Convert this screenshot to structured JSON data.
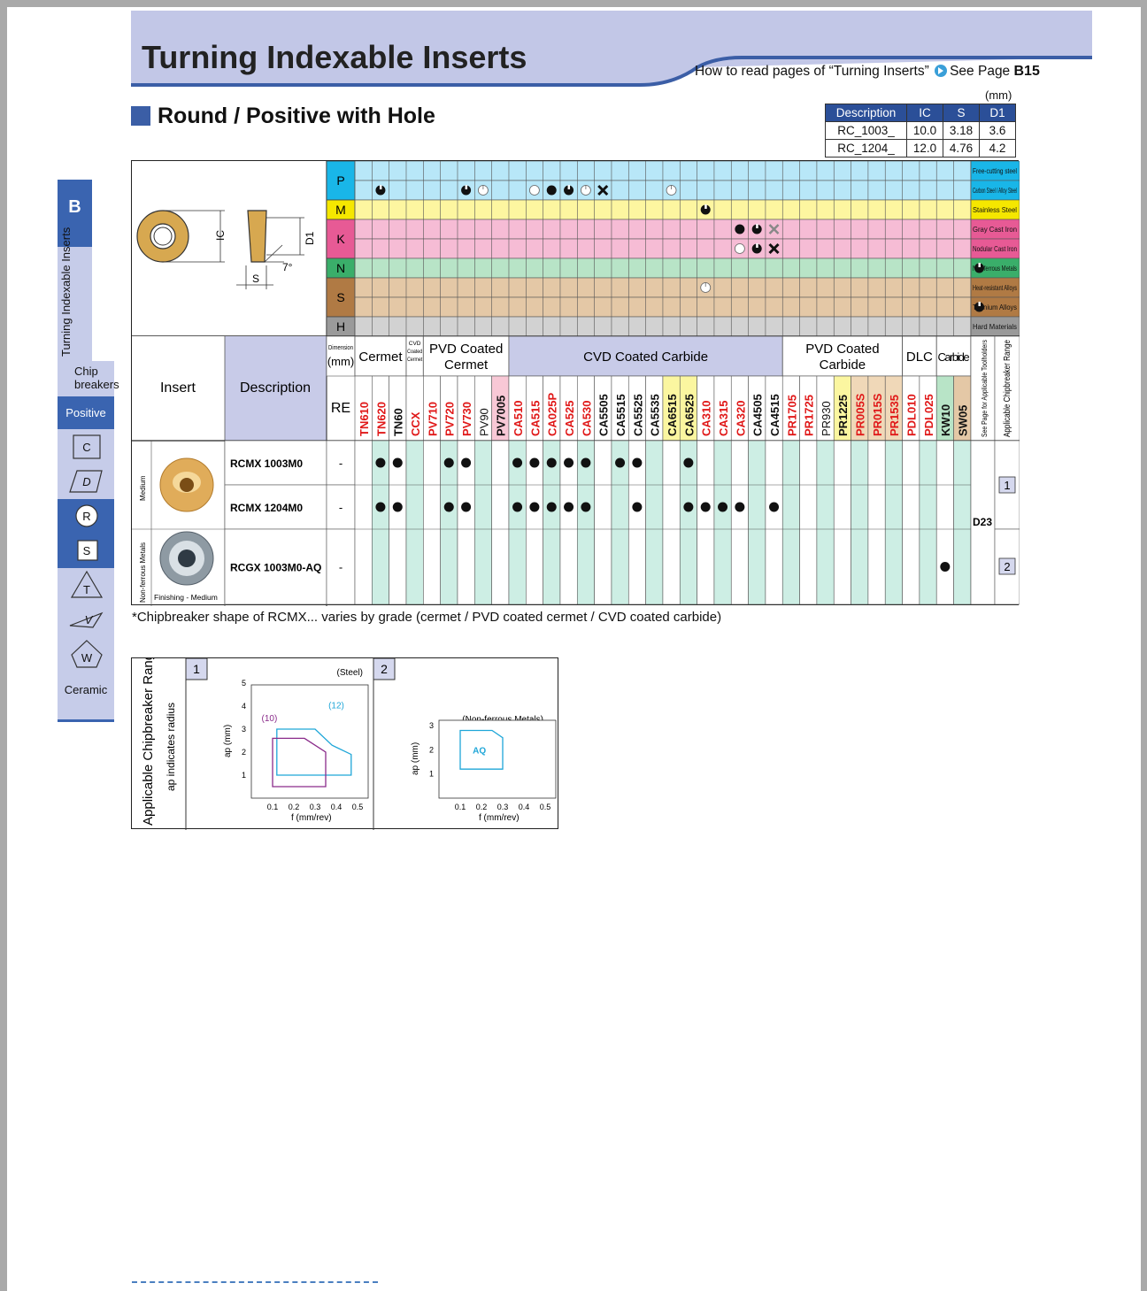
{
  "header": {
    "title": "Turning Indexable Inserts",
    "howto_text": "How to read pages of “Turning Inserts”",
    "see_page_text": "See Page",
    "see_page_ref": "B15"
  },
  "section": {
    "title": "Round / Positive with Hole"
  },
  "dimensions": {
    "unit": "(mm)",
    "headers": [
      "Description",
      "IC",
      "S",
      "D1"
    ],
    "rows": [
      [
        "RC_1003_",
        "10.0",
        "3.18",
        "3.6"
      ],
      [
        "RC_1204_",
        "12.0",
        "4.76",
        "4.2"
      ]
    ]
  },
  "sidebar": {
    "tab_letter": "B",
    "tab_vertical": "Turning Indexable Inserts",
    "items": [
      "Chip breakers",
      "Positive",
      "C",
      "D",
      "R",
      "S",
      "T",
      "V",
      "W",
      "Ceramic"
    ]
  },
  "diagram": {
    "labels": [
      "IC",
      "D1",
      "S",
      "7°"
    ]
  },
  "materials": [
    {
      "letter": "P",
      "color": "#19b6e8",
      "rows": [
        "Free-cutting steel",
        "Carbon Steel / Alloy Steel"
      ]
    },
    {
      "letter": "M",
      "color": "#f5e700",
      "rows": [
        "Stainless Steel"
      ]
    },
    {
      "letter": "K",
      "color": "#e75a95",
      "rows": [
        "Gray Cast Iron",
        "Nodular Cast Iron"
      ]
    },
    {
      "letter": "N",
      "color": "#3aae6a",
      "rows": [
        "Non-ferrous Metals"
      ]
    },
    {
      "letter": "S",
      "color": "#b07a44",
      "rows": [
        "Heat-resistant Alloys",
        "Titanium Alloys"
      ]
    },
    {
      "letter": "H",
      "color": "#9a9a9a",
      "rows": [
        "Hard Materials"
      ]
    }
  ],
  "table": {
    "insert_header": "Insert",
    "description_header": "Description",
    "dimension_header": "Dimension (mm)",
    "re_header": "RE",
    "groups": [
      "Cermet",
      "CVD Coated Cermet",
      "PVD Coated Cermet",
      "CVD Coated Carbide",
      "PVD Coated Carbide",
      "DLC",
      "Carbide"
    ],
    "see_page_toolholders": "See Page for Applicable Toolholders",
    "chipbreaker_range": "Applicable Chipbreaker Range",
    "grades": [
      "TN610",
      "TN620",
      "TN60",
      "CCX",
      "PV710",
      "PV720",
      "PV730",
      "PV90",
      "PV7005",
      "CA510",
      "CA515",
      "CA025P",
      "CA525",
      "CA530",
      "CA5505",
      "CA5515",
      "CA5525",
      "CA5535",
      "CA6515",
      "CA6525",
      "CA310",
      "CA315",
      "CA320",
      "CA4505",
      "CA4515",
      "PR1705",
      "PR1725",
      "PR930",
      "PR1225",
      "PR005S",
      "PR015S",
      "PR1535",
      "PDL010",
      "PDL025",
      "KW10",
      "SW05"
    ],
    "rows": [
      {
        "category": "Medium",
        "description": "RCMX 1003M0",
        "re": "-"
      },
      {
        "category": "Medium",
        "description": "RCMX 1204M0",
        "re": "-"
      },
      {
        "category": "Non-ferrous Metals",
        "sub": "Finishing - Medium",
        "description": "RCGX 1003M0-AQ",
        "re": "-"
      }
    ],
    "toolholder_page": "D23",
    "chipbreaker_ranges": [
      "1",
      "2"
    ]
  },
  "note": "*Chipbreaker shape of RCMX... varies by grade (cermet / PVD coated cermet / CVD coated carbide)",
  "chipbreaker_box": {
    "title": "Applicable Chipbreaker Range",
    "subtitle": "ap indicates radius",
    "panels": [
      {
        "num": "1",
        "material": "(Steel)",
        "ylabel": "ap (mm)",
        "xlabel": "f (mm/rev)",
        "yticks": [
          "1",
          "2",
          "3",
          "4",
          "5"
        ],
        "xticks": [
          "0.1",
          "0.2",
          "0.3",
          "0.4",
          "0.5"
        ],
        "labels": [
          "(10)",
          "(12)"
        ]
      },
      {
        "num": "2",
        "material": "(Non-ferrous Metals)",
        "ylabel": "ap (mm)",
        "xlabel": "f (mm/rev)",
        "yticks": [
          "1",
          "2",
          "3"
        ],
        "xticks": [
          "0.1",
          "0.2",
          "0.3",
          "0.4",
          "0.5"
        ],
        "labels": [
          "AQ"
        ]
      }
    ]
  }
}
